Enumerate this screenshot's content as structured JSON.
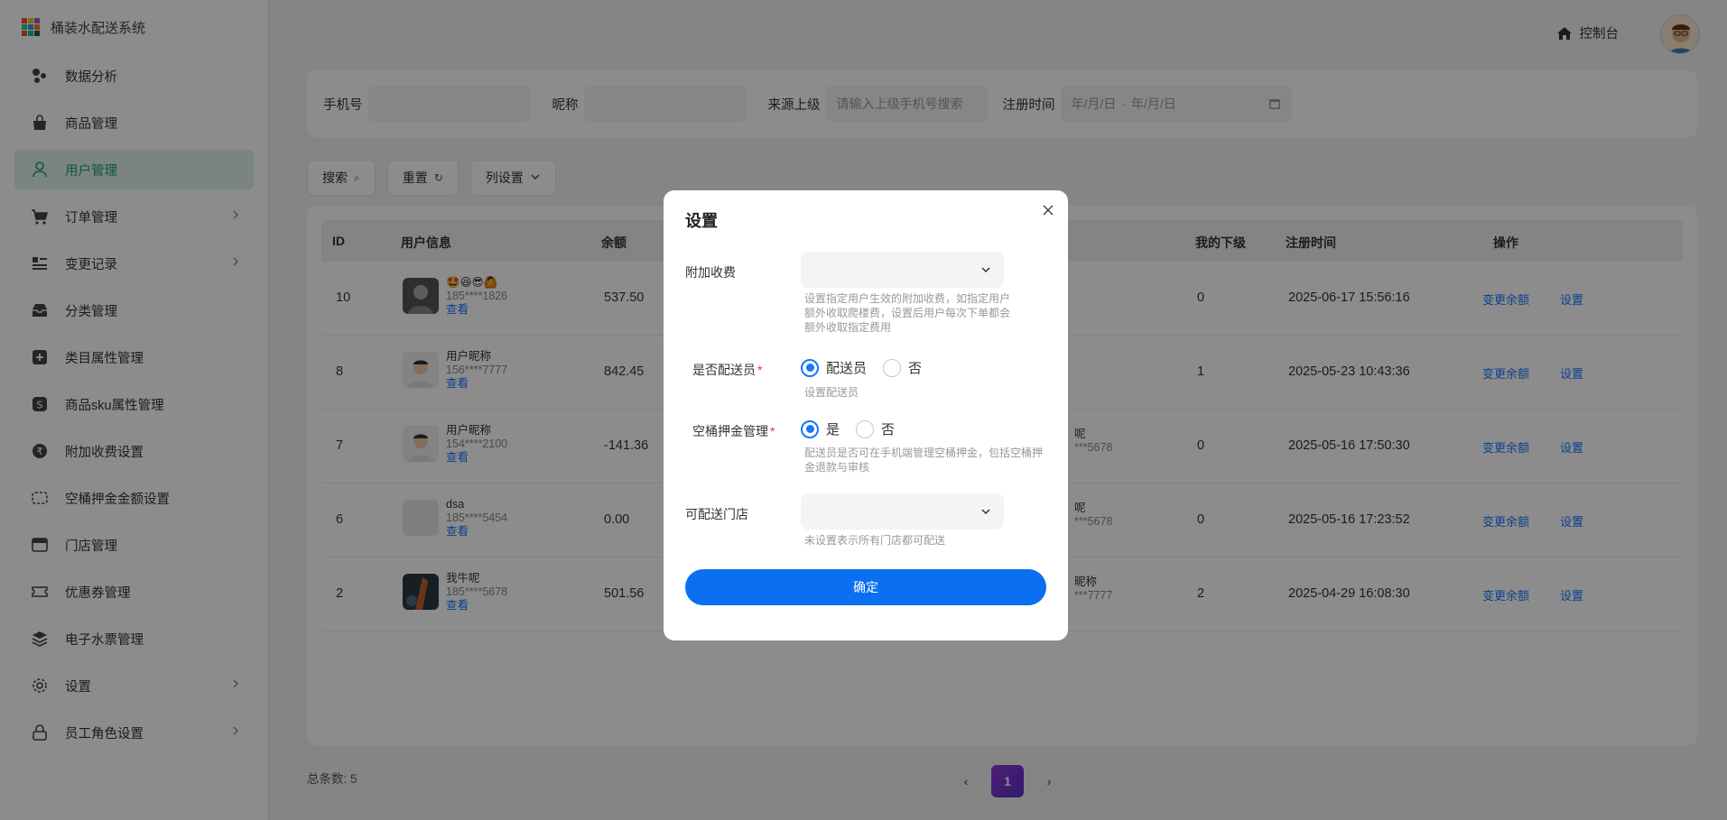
{
  "app": {
    "name": "桶装水配送系统"
  },
  "sidebar": {
    "items": [
      {
        "label": "数据分析",
        "icon": "dots-icon",
        "active": false,
        "has_arrow": false
      },
      {
        "label": "商品管理",
        "icon": "bag-icon",
        "active": false,
        "has_arrow": false
      },
      {
        "label": "用户管理",
        "icon": "user-icon",
        "active": true,
        "has_arrow": false
      },
      {
        "label": "订单管理",
        "icon": "cart-icon",
        "active": false,
        "has_arrow": true
      },
      {
        "label": "变更记录",
        "icon": "list-icon",
        "active": false,
        "has_arrow": true
      },
      {
        "label": "分类管理",
        "icon": "inbox-icon",
        "active": false,
        "has_arrow": false
      },
      {
        "label": "类目属性管理",
        "icon": "plus-square-icon",
        "active": false,
        "has_arrow": false
      },
      {
        "label": "商品sku属性管理",
        "icon": "s-badge-icon",
        "active": false,
        "has_arrow": false
      },
      {
        "label": "附加收费设置",
        "icon": "rupee-icon",
        "active": false,
        "has_arrow": false
      },
      {
        "label": "空桶押金金额设置",
        "icon": "bucket-icon",
        "active": false,
        "has_arrow": false
      },
      {
        "label": "门店管理",
        "icon": "store-icon",
        "active": false,
        "has_arrow": false
      },
      {
        "label": "优惠券管理",
        "icon": "ticket-icon",
        "active": false,
        "has_arrow": false
      },
      {
        "label": "电子水票管理",
        "icon": "layers-icon",
        "active": false,
        "has_arrow": false
      },
      {
        "label": "设置",
        "icon": "gear-icon",
        "active": false,
        "has_arrow": true
      },
      {
        "label": "员工角色设置",
        "icon": "lock-icon",
        "active": false,
        "has_arrow": true
      }
    ]
  },
  "header": {
    "console_label": "控制台"
  },
  "filters": {
    "phone_label": "手机号",
    "nickname_label": "昵称",
    "source_label": "来源上级",
    "source_placeholder": "请输入上级手机号搜索",
    "reg_time_label": "注册时间",
    "date_start": "年/月/日",
    "date_sep": "-",
    "date_end": "年/月/日"
  },
  "toolbar": {
    "search": "搜索",
    "reset": "重置",
    "columns": "列设置"
  },
  "table": {
    "headers": {
      "id": "ID",
      "user": "用户信息",
      "balance": "余额",
      "sub": "我的下级",
      "reg_time": "注册时间",
      "ops": "操作"
    },
    "view_label": "查看",
    "change_balance_label": "变更余额",
    "settings_label": "设置",
    "rows": [
      {
        "id": "10",
        "name": "🤩😆😎🙆",
        "phone": "185****1826",
        "balance": "537.50",
        "source_name": "",
        "source_phone": "",
        "sub": "0",
        "reg_time": "2025-06-17 15:56:16"
      },
      {
        "id": "8",
        "name": "用户昵称",
        "phone": "156****7777",
        "balance": "842.45",
        "source_name": "",
        "source_phone": "",
        "sub": "1",
        "reg_time": "2025-05-23 10:43:36"
      },
      {
        "id": "7",
        "name": "用户昵称",
        "phone": "154****2100",
        "balance": "-141.36",
        "source_name": "呢",
        "source_phone": "***5678",
        "sub": "0",
        "reg_time": "2025-05-16 17:50:30"
      },
      {
        "id": "6",
        "name": "dsa",
        "phone": "185****5454",
        "balance": "0.00",
        "source_name": "呢",
        "source_phone": "***5678",
        "sub": "0",
        "reg_time": "2025-05-16 17:23:52"
      },
      {
        "id": "2",
        "name": "我牛呢",
        "phone": "185****5678",
        "balance": "501.56",
        "source_name": "昵称",
        "source_phone": "***7777",
        "sub": "2",
        "reg_time": "2025-04-29 16:08:30"
      }
    ]
  },
  "footer": {
    "total_label": "总条数: 5",
    "current_page": "1",
    "prev": "‹",
    "next": "›"
  },
  "modal": {
    "title": "设置",
    "extra_fee_label": "附加收费",
    "extra_fee_help": "设置指定用户生效的附加收费，如指定用户额外收取​爬楼费，设置后用户每次下单都会额外收取指定费用",
    "is_courier_label": "是否配送员",
    "courier_yes": "配送员",
    "courier_no": "否",
    "courier_help": "设置配送员",
    "deposit_label": "空桶押金管理",
    "deposit_yes": "是",
    "deposit_no": "否",
    "deposit_help": "配送员是否可在手机端管理空桶押金，包括空桶押金退款与审核",
    "store_label": "可配送门店",
    "store_help": "未设置表示所有门店都可配送",
    "confirm": "确定"
  },
  "colors": {
    "primary": "#0a6ff0",
    "active_menu_bg": "#dff0ea",
    "active_menu_text": "#1a9e6e",
    "link": "#1677ff",
    "required": "#e33333"
  }
}
